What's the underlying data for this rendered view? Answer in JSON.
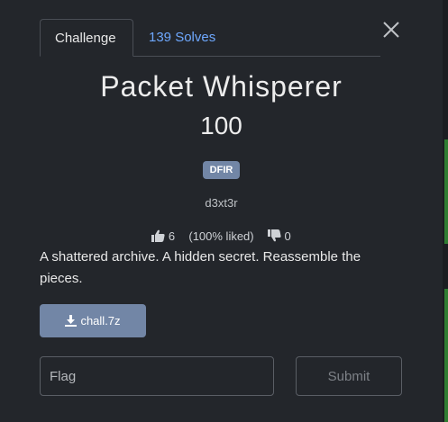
{
  "tabs": {
    "challenge_label": "Challenge",
    "solves_label": "139 Solves"
  },
  "challenge": {
    "title": "Packet Whisperer",
    "points": "100",
    "category": "DFIR",
    "author": "d3xt3r",
    "likes": "6",
    "like_percent": "(100% liked)",
    "dislikes": "0",
    "description": "A shattered archive. A hidden secret. Reassemble the pieces.",
    "file_name": "chall.7z"
  },
  "form": {
    "flag_placeholder": "Flag",
    "submit_label": "Submit"
  },
  "icons": {
    "close": "close-icon",
    "thumbs_up": "thumbs-up-icon",
    "thumbs_down": "thumbs-down-icon",
    "download": "download-icon"
  },
  "colors": {
    "background": "#23262b",
    "link": "#6ea8fe",
    "badge": "#7286a6",
    "button": "#7286a6"
  }
}
